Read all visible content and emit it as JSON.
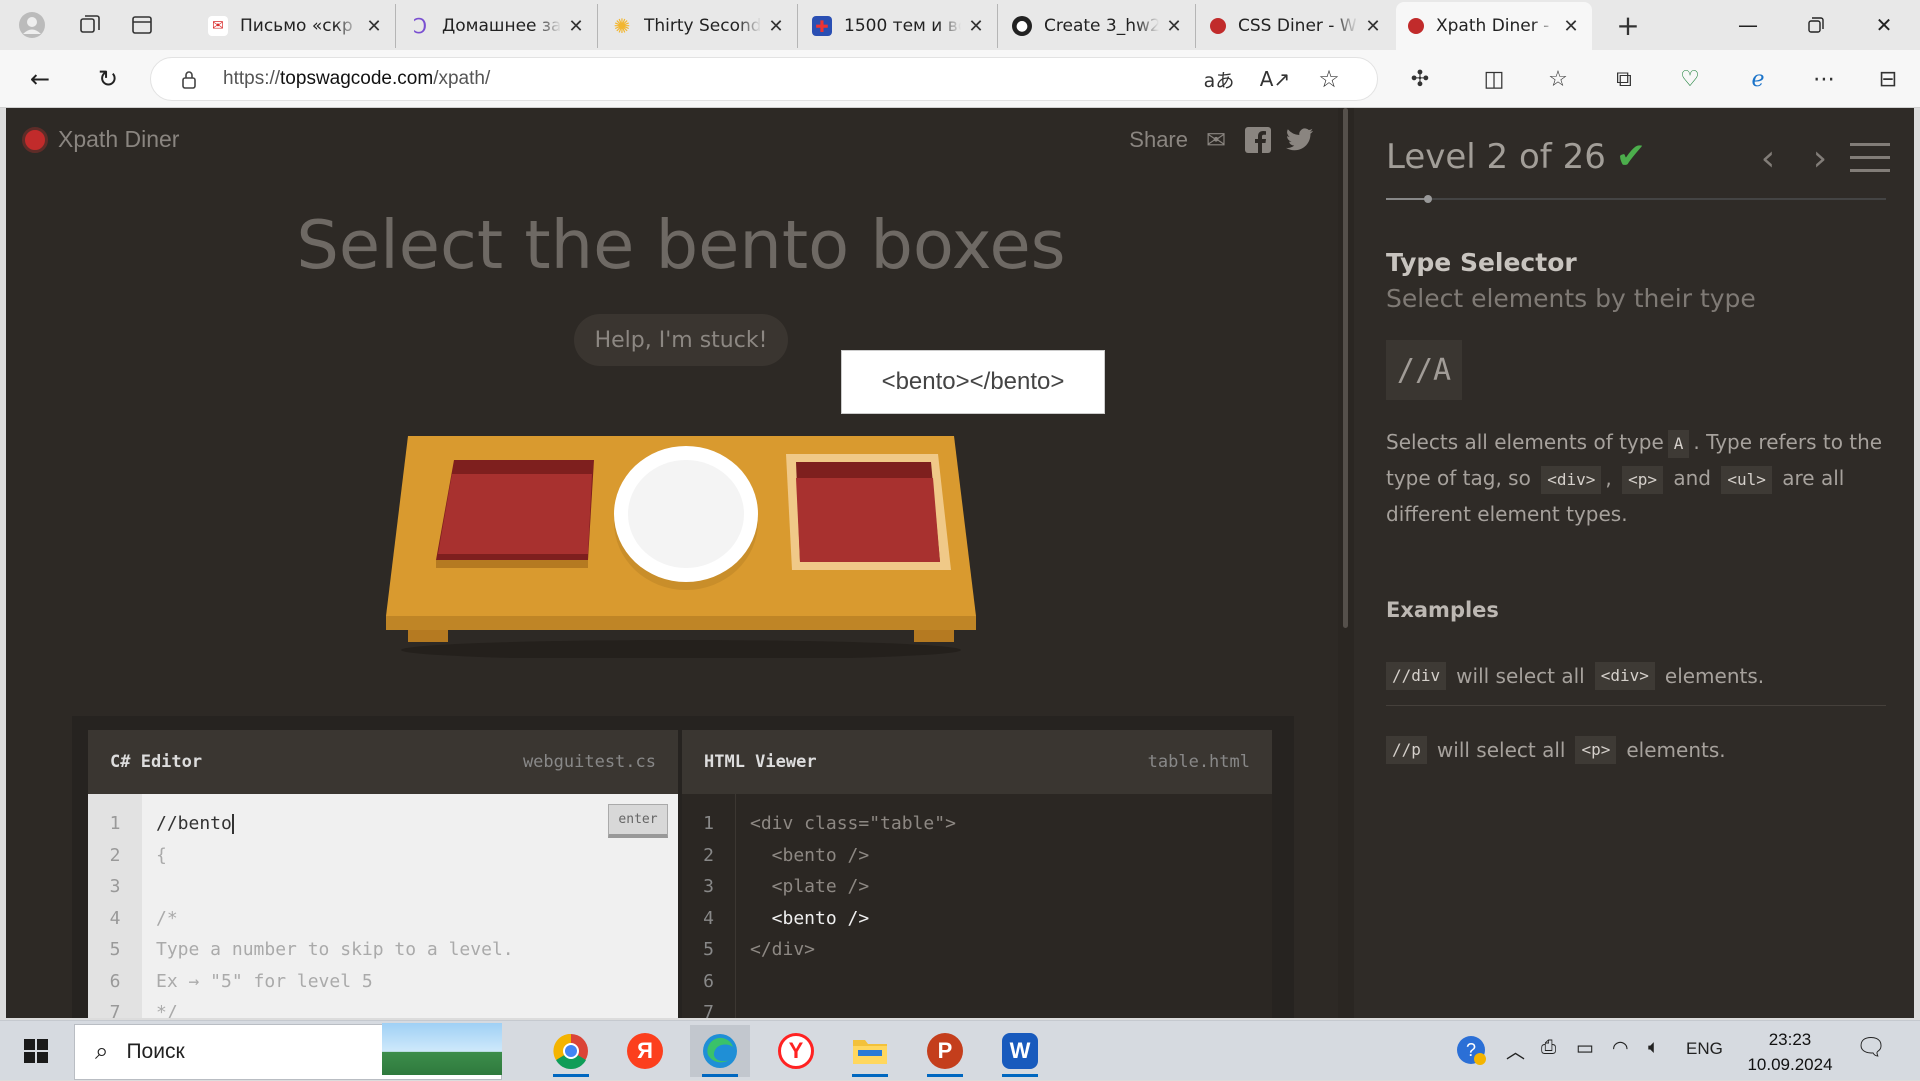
{
  "browser": {
    "tabs": [
      {
        "title": "Письмо «скр",
        "color": "#d92b2b"
      },
      {
        "title": "Домашнее за",
        "color": "#7a4fd1"
      },
      {
        "title": "Thirty Second",
        "color": "#f2b630"
      },
      {
        "title": "1500 тем и вс",
        "color": "#2a4fb3"
      },
      {
        "title": "Create 3_hw2",
        "color": "#222222"
      },
      {
        "title": "CSS Diner - W",
        "color": "#c12b2b"
      },
      {
        "title": "Xpath Diner -",
        "color": "#c12b2b"
      }
    ],
    "url_prefix": "https://",
    "url_domain": "topswagcode.com",
    "url_path": "/xpath/"
  },
  "game": {
    "logo": "Xpath Diner",
    "share_label": "Share",
    "order": "Select the bento boxes",
    "help_button": "Help, I'm stuck!",
    "tooltip": "<bento></bento>"
  },
  "editor": {
    "left_title": "C# Editor",
    "left_file": "webguitest.cs",
    "right_title": "HTML Viewer",
    "right_file": "table.html",
    "enter_label": "enter",
    "left_lines": [
      "//bento",
      "{",
      "",
      "/*",
      "Type a number to skip to a level.",
      "Ex → \"5\" for level 5",
      "*/"
    ],
    "right_lines": [
      "<div class=\"table\">",
      "  <bento />",
      "  <plate />",
      "  <bento />",
      "</div>",
      "",
      ""
    ],
    "line_numbers": [
      "1",
      "2",
      "3",
      "4",
      "5",
      "6",
      "7"
    ]
  },
  "sidebar": {
    "level": "Level 2 of 26",
    "title": "Type Selector",
    "subtitle": "Select elements by their type",
    "syntax": "//A",
    "desc_1": "Selects all elements of type",
    "desc_code_a": "A",
    "desc_2": ". Type refers to the type of tag, so",
    "code_div": "<div>",
    "comma": ",",
    "code_p": "<p>",
    "and": "and",
    "code_ul": "<ul>",
    "desc_3": "are all different element types.",
    "examples_heading": "Examples",
    "ex1_code": "//div",
    "ex1_text": "will select all",
    "ex1_tag": "<div>",
    "ex1_end": "elements.",
    "ex2_code": "//p",
    "ex2_text": "will select all",
    "ex2_tag": "<p>",
    "ex2_end": "elements."
  },
  "taskbar": {
    "search": "Поиск",
    "lang": "ENG",
    "time": "23:23",
    "date": "10.09.2024"
  },
  "colors": {
    "table_wood": "#d99a2f",
    "bento_red": "#a8312f",
    "accent_green": "#4cae4c"
  }
}
